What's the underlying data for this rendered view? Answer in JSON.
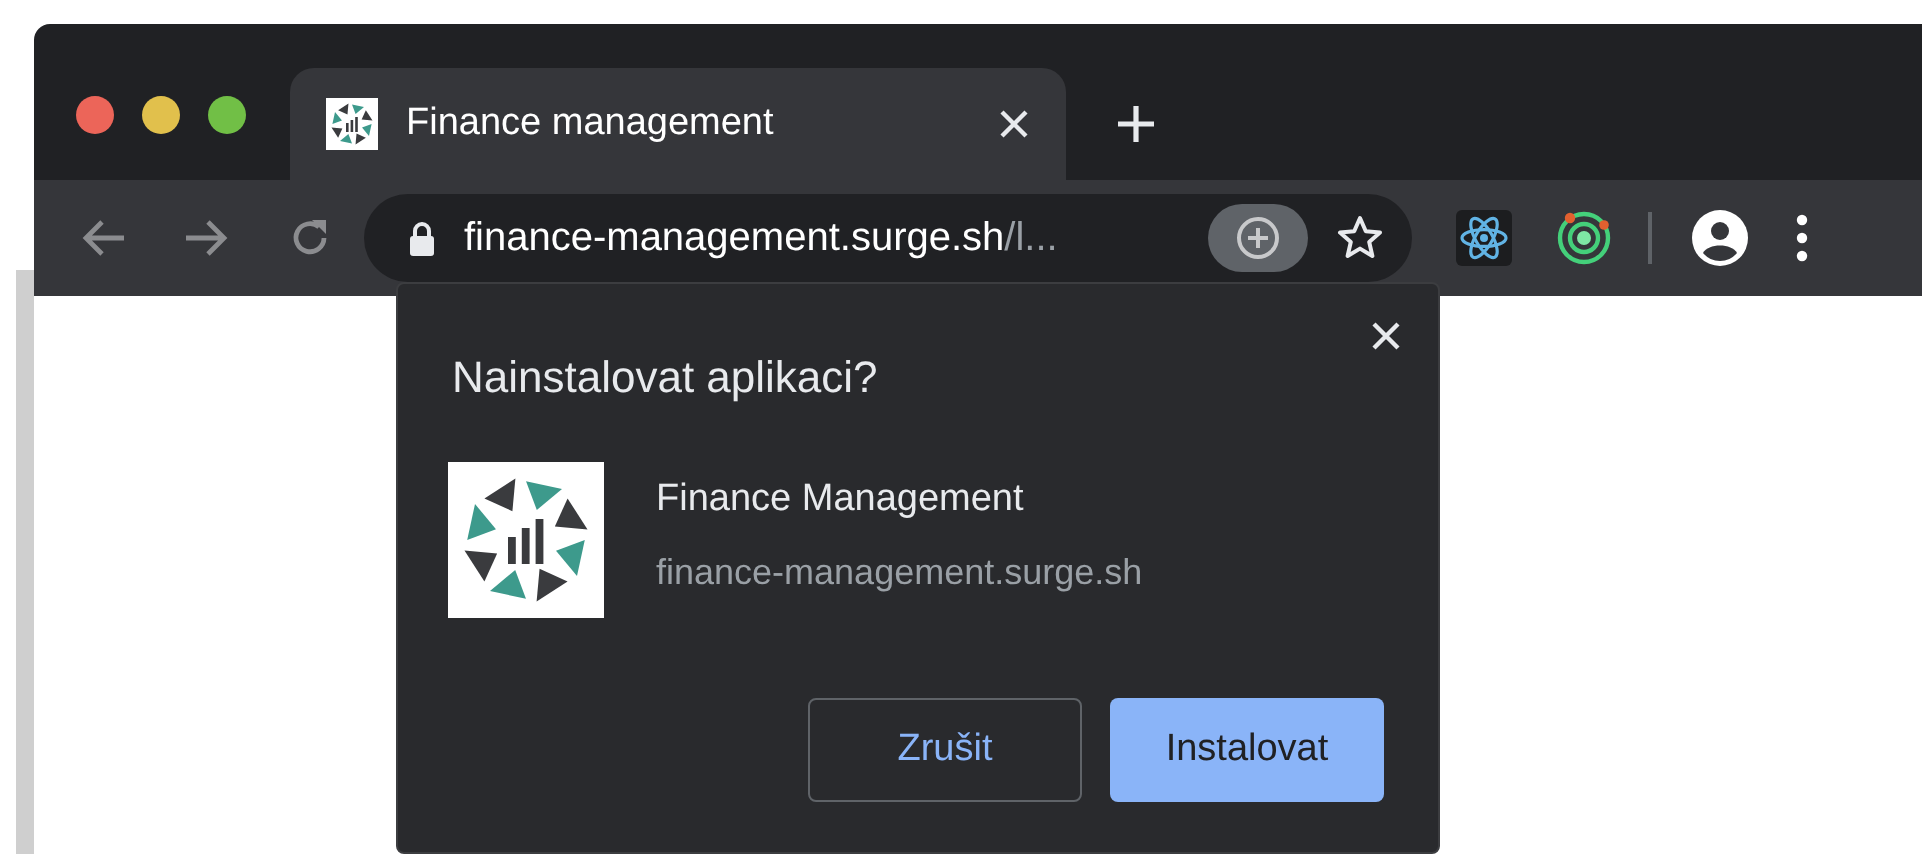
{
  "tab": {
    "title": "Finance management"
  },
  "omnibox": {
    "host": "finance-management.surge.sh",
    "path": "/l..."
  },
  "dialog": {
    "title": "Nainstalovat aplikaci?",
    "app_name": "Finance Management",
    "app_origin": "finance-management.surge.sh",
    "buttons": [
      {
        "label": "Zrušit",
        "kind": "secondary"
      },
      {
        "label": "Instalovat",
        "kind": "primary"
      }
    ]
  }
}
